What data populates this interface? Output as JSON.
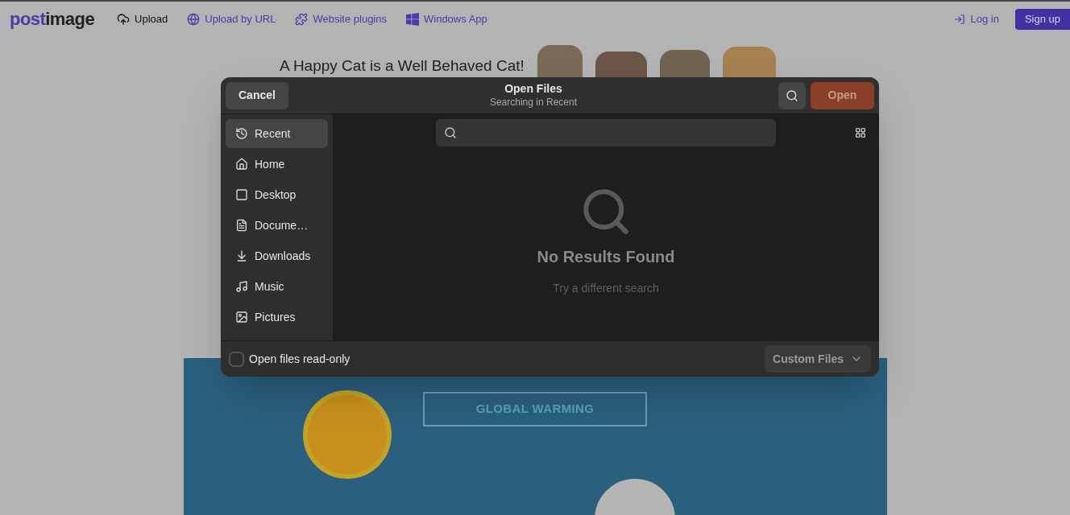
{
  "site": {
    "logo": {
      "part_1": "post",
      "part_2": "image"
    },
    "nav": [
      {
        "kind": "upload",
        "label": "Upload",
        "selected": true
      },
      {
        "kind": "url",
        "label": "Upload by URL",
        "selected": false
      },
      {
        "kind": "plugins",
        "label": "Website plugins",
        "selected": false
      },
      {
        "kind": "windows",
        "label": "Windows App",
        "selected": false
      }
    ],
    "login": "Log in",
    "signup": "Sign up",
    "banner": {
      "caption": "A Happy Cat is a Well Behaved Cat!"
    },
    "illustration": {
      "title": "GLOBAL WARMING"
    }
  },
  "dialog": {
    "cancel": "Cancel",
    "title": "Open Files",
    "subtitle": "Searching in Recent",
    "open": {
      "label": "Open",
      "disabled": true
    },
    "sidebar": [
      {
        "kind": "recent",
        "label": "Recent",
        "selected": true
      },
      {
        "kind": "home",
        "label": "Home",
        "selected": false
      },
      {
        "kind": "desktop",
        "label": "Desktop",
        "selected": false
      },
      {
        "kind": "documents",
        "label": "Docume…",
        "selected": false
      },
      {
        "kind": "downloads",
        "label": "Downloads",
        "selected": false
      },
      {
        "kind": "music",
        "label": "Music",
        "selected": false
      },
      {
        "kind": "pictures",
        "label": "Pictures",
        "selected": false
      }
    ],
    "empty": {
      "title": "No Results Found",
      "hint": "Try a different search"
    },
    "read_only": {
      "label": "Open files read-only",
      "checked": false
    },
    "filter": "Custom Files"
  }
}
